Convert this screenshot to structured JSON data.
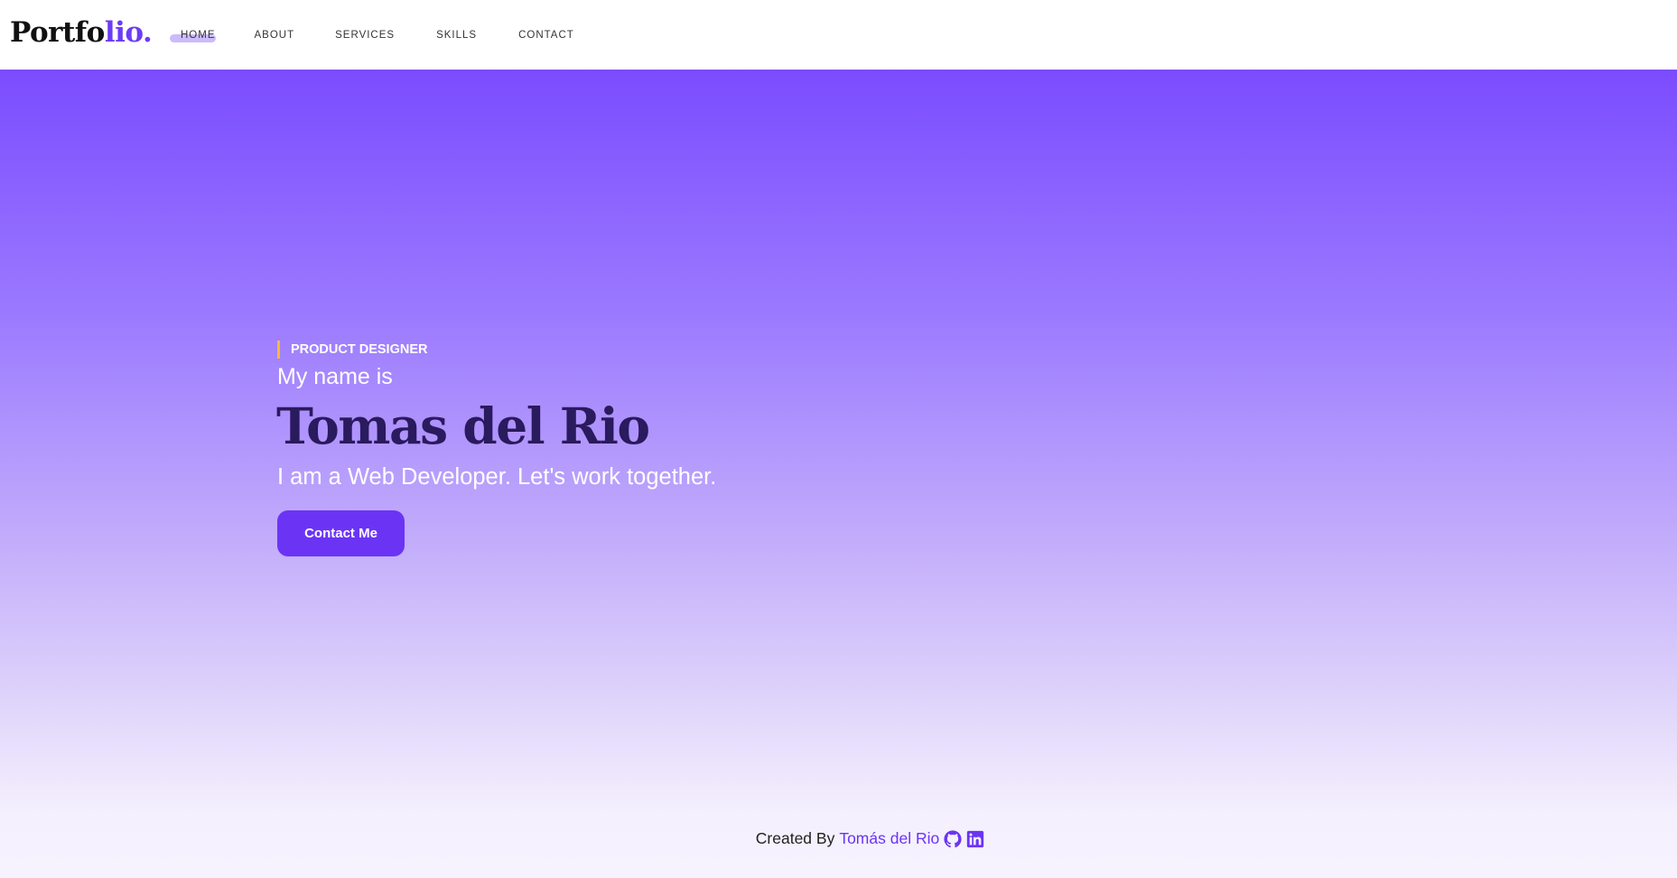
{
  "brand": {
    "logo_main": "Portfo",
    "logo_accent": "lio."
  },
  "nav": {
    "items": [
      {
        "label": "HOME",
        "active": true
      },
      {
        "label": "ABOUT",
        "active": false
      },
      {
        "label": "SERVICES",
        "active": false
      },
      {
        "label": "SKILLS",
        "active": false
      },
      {
        "label": "CONTACT",
        "active": false
      }
    ]
  },
  "hero": {
    "tag": "PRODUCT DESIGNER",
    "intro": "My name is",
    "name": "Tomas del Rio",
    "subtitle": "I am a Web Developer. Let's work together.",
    "cta_label": "Contact Me"
  },
  "footer": {
    "created_by": "Created By",
    "author": "Tomás del Rio",
    "icons": [
      "github-icon",
      "linkedin-icon"
    ]
  },
  "colors": {
    "accent": "#6b34f5",
    "hero_gradient_top": "#7b4cff",
    "hero_gradient_bottom": "#f6f2fe",
    "name_color": "#2a1a5e",
    "tag_bar": "#f5b841",
    "nav_highlight": "#cbbbfb"
  }
}
